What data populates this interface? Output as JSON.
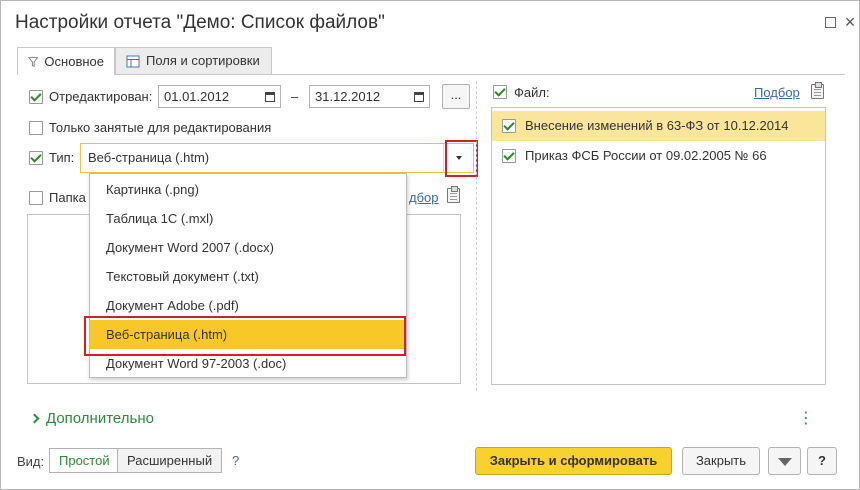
{
  "window": {
    "title": "Настройки отчета \"Демо: Список файлов\"",
    "more_glyph": "⋮",
    "close_glyph": "×"
  },
  "tabs": [
    {
      "label": "Основное",
      "icon": "filter-icon"
    },
    {
      "label": "Поля и сортировки",
      "icon": "fields-sort-icon"
    }
  ],
  "edited": {
    "label": "Отредактирован:",
    "checked": true,
    "date_from": "01.01.2012",
    "date_to": "31.12.2012",
    "dash": "–",
    "more_button": "..."
  },
  "busy": {
    "label": "Только занятые для редактирования",
    "checked": false
  },
  "type": {
    "label": "Тип:",
    "checked": true,
    "value": "Веб-страница (.htm)"
  },
  "folder": {
    "label": "Папка",
    "pick_link": "дбор"
  },
  "dropdown": {
    "options": [
      "Картинка (.png)",
      "Таблица 1С (.mxl)",
      "Документ Word 2007 (.docx)",
      "Текстовый документ (.txt)",
      "Документ Adobe (.pdf)",
      "Веб-страница (.htm)",
      "Документ Word 97-2003 (.doc)"
    ],
    "selected_index": 5
  },
  "file": {
    "label": "Файл:",
    "checked": true,
    "pick_link": "Подбор",
    "items": [
      {
        "text": "Внесение изменений в 63-ФЗ от  10.12.2014",
        "checked": true,
        "selected": true
      },
      {
        "text": "Приказ ФСБ России от 09.02.2005 № 66",
        "checked": true,
        "selected": false
      }
    ]
  },
  "additional": {
    "label": "Дополнительно"
  },
  "view": {
    "label": "Вид:",
    "simple": "Простой",
    "extended": "Расширенный",
    "help": "?"
  },
  "buttons": {
    "close_and_build": "Закрыть и сформировать",
    "close": "Закрыть",
    "help": "?"
  },
  "colors": {
    "accent_yellow": "#f8d12c",
    "selection_yellow": "#f7c827",
    "highlight_red": "#d0202a",
    "link_blue": "#3a6aa8",
    "green": "#2e8b3c"
  }
}
